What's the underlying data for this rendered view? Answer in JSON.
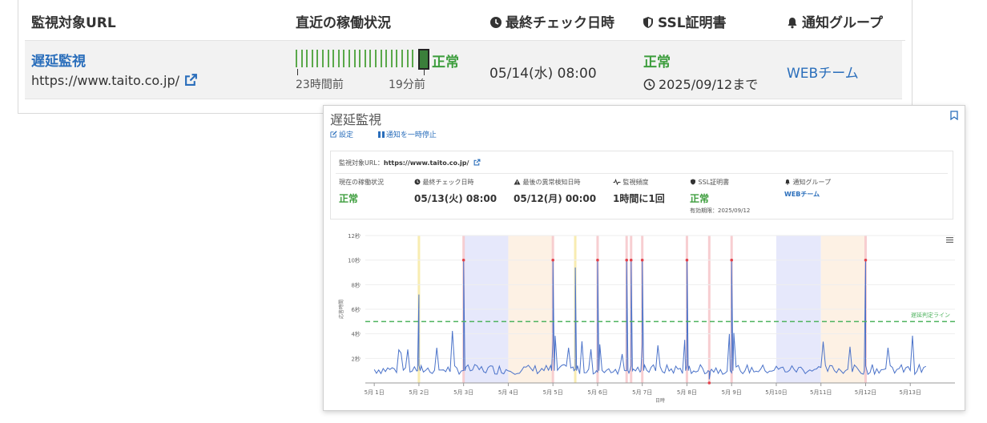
{
  "table": {
    "headers": {
      "url": "監視対象URL",
      "uptime": "直近の稼働状況",
      "last_check": "最終チェック日時",
      "ssl": "SSL証明書",
      "group": "通知グループ"
    },
    "row": {
      "name": "遅延監視",
      "url": "https://www.taito.co.jp/",
      "uptime_status": "正常",
      "uptime_from": "23時間前",
      "uptime_to": "19分前",
      "last_check": "05/14(水) 08:00",
      "ssl_status": "正常",
      "ssl_expiry": "2025/09/12まで",
      "group": "WEBチーム"
    }
  },
  "detail": {
    "title": "遅延監視",
    "actions": {
      "settings": "設定",
      "pause": "通知を一時停止"
    },
    "url_label": "監視対象URL：",
    "url": "https://www.taito.co.jp/",
    "columns": {
      "status_label": "現在の稼働状況",
      "status_value": "正常",
      "last_check_label": "最終チェック日時",
      "last_check_value": "05/13(火) 08:00",
      "last_error_label": "最後の異常検知日時",
      "last_error_value": "05/12(月) 00:00",
      "frequency_label": "監視頻度",
      "frequency_value": "1時間に1回",
      "ssl_label": "SSL証明書",
      "ssl_value": "正常",
      "ssl_expiry": "有効期限：2025/09/12",
      "group_label": "通知グループ",
      "group_value": "WEBチーム"
    }
  },
  "chart_data": {
    "type": "line",
    "xlabel": "日時",
    "ylabel": "応答時間",
    "y_ticks": [
      "2秒",
      "4秒",
      "6秒",
      "8秒",
      "10秒",
      "12秒"
    ],
    "ylim": [
      0,
      12
    ],
    "xlim": [
      0.8,
      14.0
    ],
    "x_ticks": [
      {
        "x": 1,
        "label": "5月 1日"
      },
      {
        "x": 2,
        "label": "5月 2日"
      },
      {
        "x": 3,
        "label": "5月 3日"
      },
      {
        "x": 4,
        "label": "5月 4日"
      },
      {
        "x": 5,
        "label": "5月 5日"
      },
      {
        "x": 6,
        "label": "5月 6日"
      },
      {
        "x": 7,
        "label": "5月 7日"
      },
      {
        "x": 8,
        "label": "5月 8日"
      },
      {
        "x": 9,
        "label": "5月 9日"
      },
      {
        "x": 10,
        "label": "5月10日"
      },
      {
        "x": 11,
        "label": "5月11日"
      },
      {
        "x": 12,
        "label": "5月12日"
      },
      {
        "x": 13,
        "label": "5月13日"
      }
    ],
    "threshold": {
      "value": 5,
      "label": "遅延判定ライン"
    },
    "bands": [
      {
        "from": 3,
        "to": 4,
        "color": "#e6e8fb"
      },
      {
        "from": 4,
        "to": 5,
        "color": "#fdf1e4"
      },
      {
        "from": 10,
        "to": 11,
        "color": "#e6e8fb"
      },
      {
        "from": 11,
        "to": 12,
        "color": "#fdf1e4"
      }
    ],
    "spikes": [
      {
        "x": 2.0,
        "y": 7.2,
        "level": "warn"
      },
      {
        "x": 3.0,
        "y": 10.0,
        "level": "error"
      },
      {
        "x": 5.0,
        "y": 10.0,
        "level": "error"
      },
      {
        "x": 5.5,
        "y": 9.4,
        "level": "warn"
      },
      {
        "x": 6.0,
        "y": 10.0,
        "level": "error"
      },
      {
        "x": 6.65,
        "y": 10.0,
        "level": "error"
      },
      {
        "x": 6.75,
        "y": 10.0,
        "level": "error"
      },
      {
        "x": 7.0,
        "y": 10.0,
        "level": "error"
      },
      {
        "x": 8.0,
        "y": 10.0,
        "level": "error"
      },
      {
        "x": 8.5,
        "y": 0.0,
        "level": "error"
      },
      {
        "x": 9.0,
        "y": 10.0,
        "level": "error"
      },
      {
        "x": 12.0,
        "y": 10.0,
        "level": "error"
      }
    ],
    "colors": {
      "line": "#4a72c9",
      "threshold": "#4fb35f",
      "error": "#e4414b",
      "warn": "#f2d23a"
    }
  },
  "colors": {
    "link": "#2a6ebb",
    "ok": "#3c9d3c"
  }
}
